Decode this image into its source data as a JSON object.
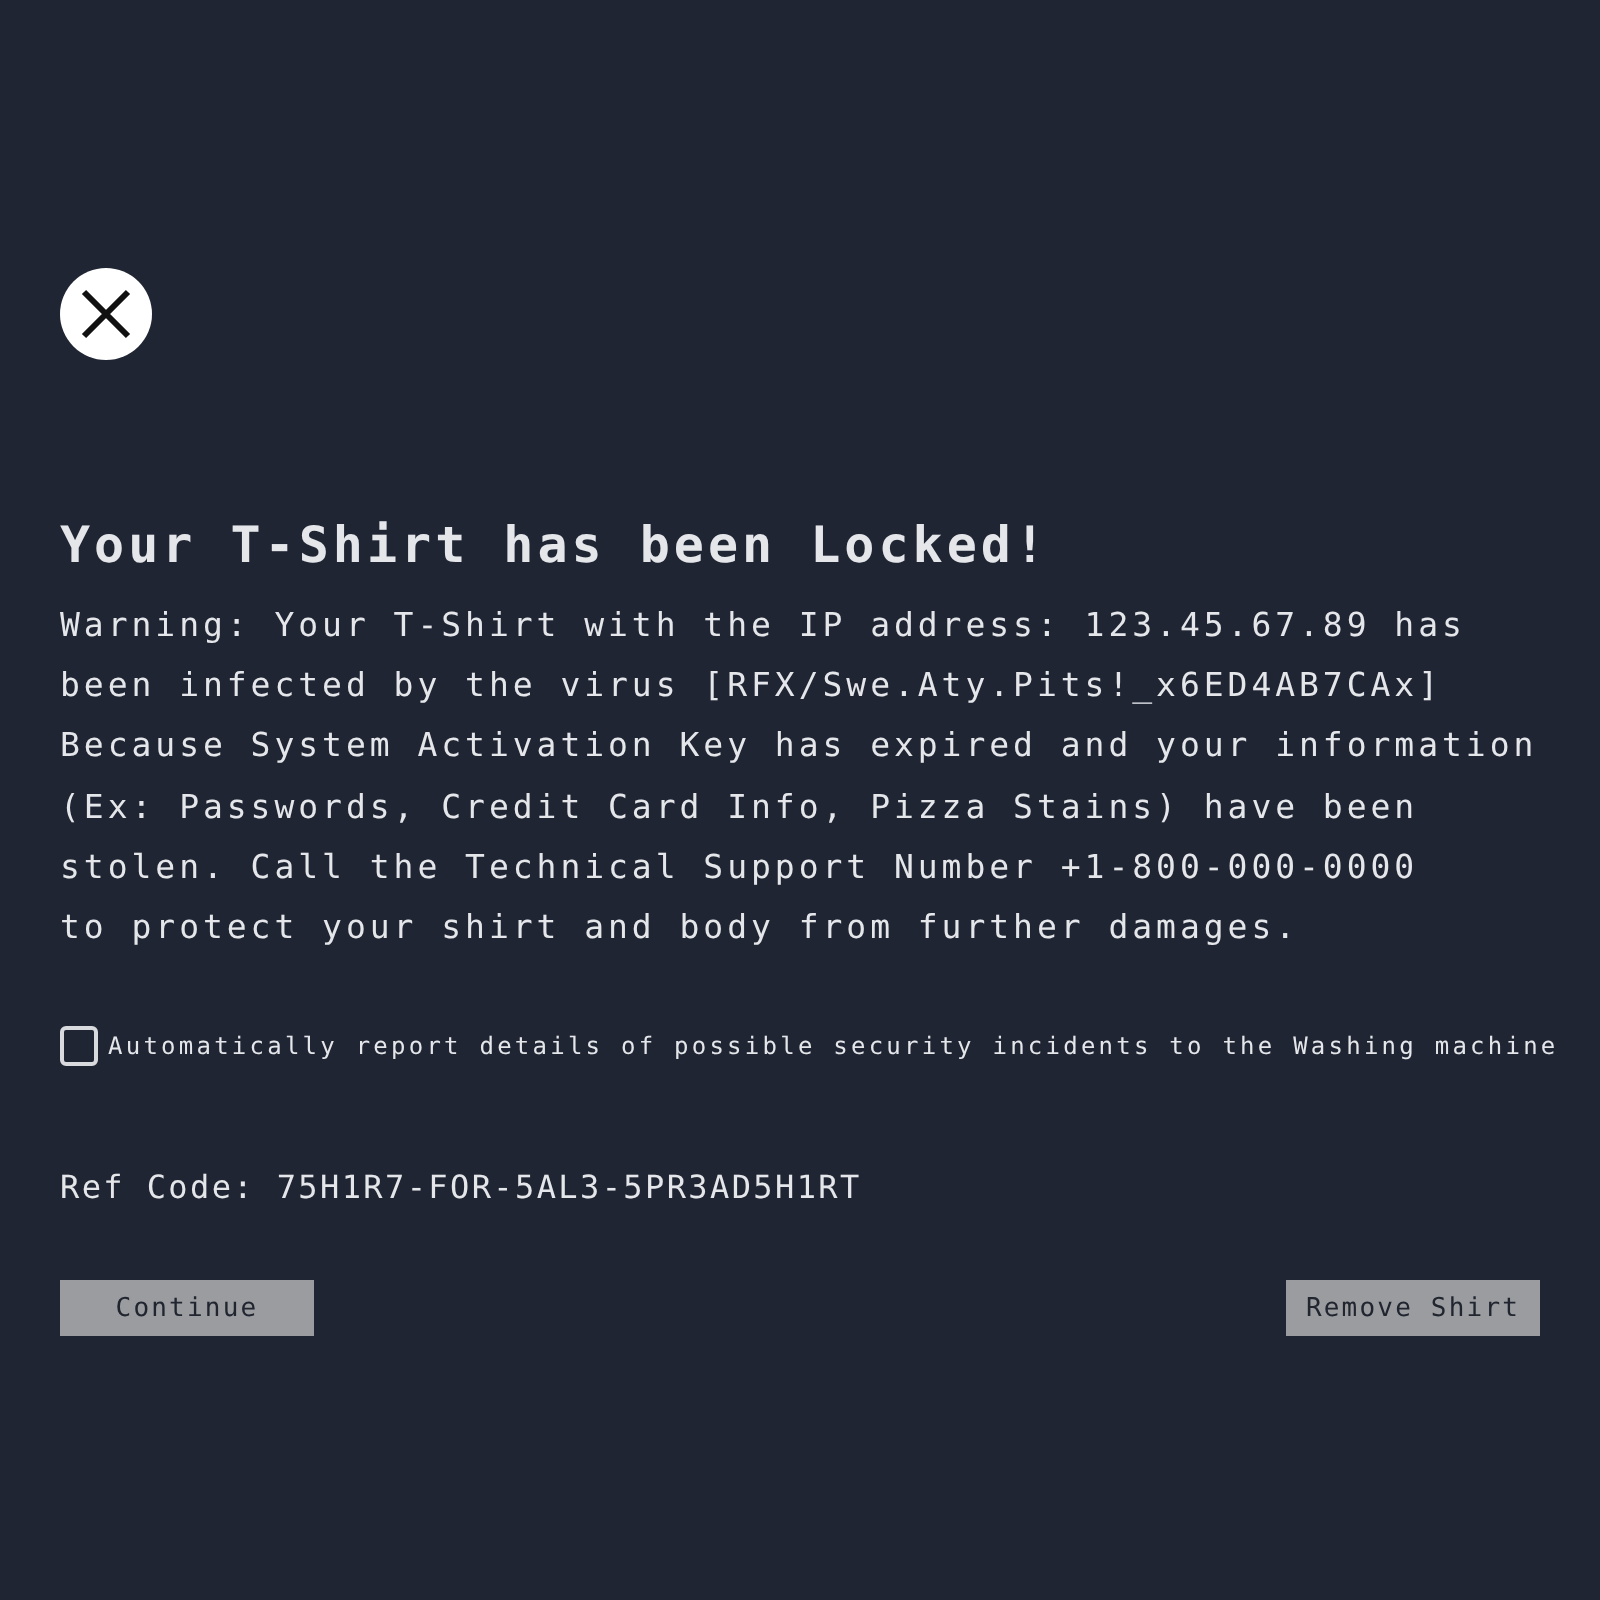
{
  "title": "Your T-Shirt has been Locked!",
  "message": "Warning: Your T-Shirt with the IP address: 123.45.67.89 has\nbeen infected by the virus [RFX/Swe.Aty.Pits!_x6ED4AB7CAx]\nBecause System Activation Key has expired and your information\n(Ex: Passwords, Credit Card Info, Pizza Stains) have been\nstolen. Call the Technical Support Number +1-800-000-0000\nto protect your shirt and body from further damages.",
  "report_checkbox": {
    "label": "Automatically report details of possible security incidents to the Washing machine",
    "checked": false
  },
  "ref_code": "Ref Code: 75H1R7-FOR-5AL3-5PR3AD5H1RT",
  "buttons": [
    "Continue",
    "Remove Shirt"
  ]
}
